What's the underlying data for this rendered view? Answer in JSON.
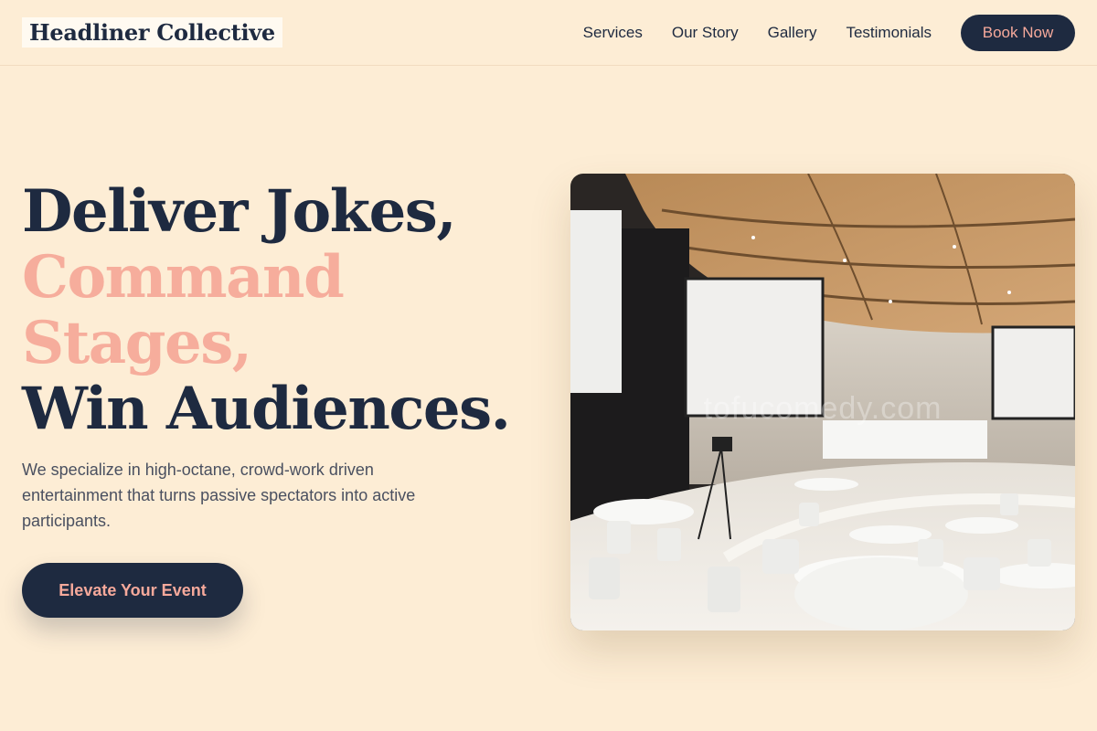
{
  "header": {
    "logo": "Headliner Collective",
    "nav": [
      "Services",
      "Our Story",
      "Gallery",
      "Testimonials"
    ],
    "cta": "Book Now"
  },
  "hero": {
    "headline": {
      "line1": "Deliver Jokes,",
      "line2": "Command",
      "line3": "Stages,",
      "line4": "Win Audiences."
    },
    "subtext": "We specialize in high-octane, crowd-work driven entertainment that turns passive spectators into active participants.",
    "cta": "Elevate Your Event",
    "image": {
      "subject": "conference-hall-photo",
      "watermark": "tofucomedy.com"
    }
  },
  "colors": {
    "background": "#fdedd5",
    "navy": "#1e2a40",
    "accent_pink": "#f6ad9c",
    "body_text": "#4a5060"
  }
}
